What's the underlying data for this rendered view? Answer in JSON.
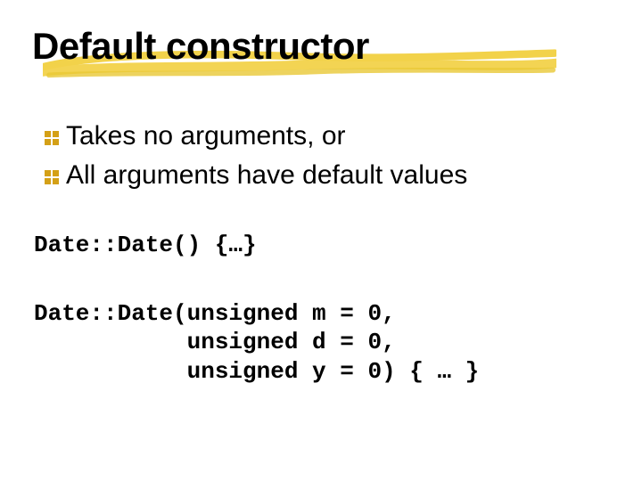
{
  "title": "Default constructor",
  "bullets": [
    "Takes no arguments, or",
    "All arguments have default values"
  ],
  "code": {
    "line1": "Date::Date() {…}",
    "line2": "Date::Date(unsigned m = 0,",
    "line3": "           unsigned d = 0,",
    "line4": "           unsigned y = 0) { … }"
  }
}
